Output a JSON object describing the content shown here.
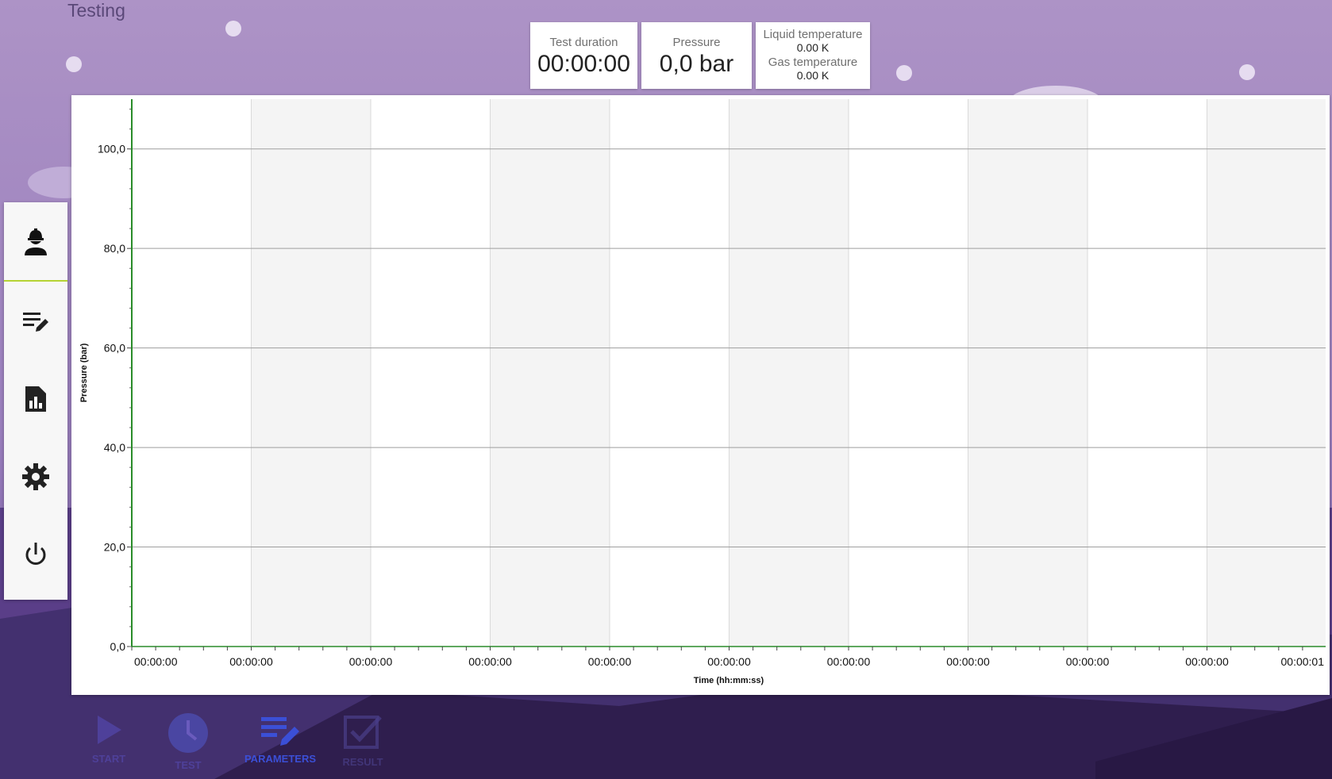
{
  "page": {
    "title": "Testing"
  },
  "stats": {
    "duration_label": "Test duration",
    "duration_value": "00:00:00",
    "pressure_label": "Pressure",
    "pressure_value": "0,0 bar",
    "liquid_temp_label": "Liquid temperature",
    "liquid_temp_value": "0.00 K",
    "gas_temp_label": "Gas temperature",
    "gas_temp_value": "0.00 K"
  },
  "sidebar": {
    "items": [
      {
        "icon": "operator-icon"
      },
      {
        "icon": "edit-list-icon"
      },
      {
        "icon": "report-icon"
      },
      {
        "icon": "gear-icon"
      },
      {
        "icon": "power-icon"
      }
    ],
    "active_index": 0
  },
  "bottom_nav": {
    "items": [
      {
        "label": "START",
        "icon": "play-icon"
      },
      {
        "label": "TEST",
        "icon": "clock-icon"
      },
      {
        "label": "PARAMETERS",
        "icon": "edit-list-icon"
      },
      {
        "label": "RESULT",
        "icon": "check-document-icon"
      }
    ],
    "active_index": 2
  },
  "colors": {
    "bg_top": "#ad93c6",
    "bg_bottom": "#43306f",
    "accent_active": "#3b4fd6",
    "axis_line": "#2a8c2a",
    "side_active_bar": "#b5d334"
  },
  "chart_data": {
    "type": "line",
    "ylabel": "Pressure (bar)",
    "xlabel": "Time (hh:mm:ss)",
    "ylim": [
      0,
      110
    ],
    "y_ticks": [
      "0,0",
      "20,0",
      "40,0",
      "60,0",
      "80,0",
      "100,0"
    ],
    "y_tick_values": [
      0,
      20,
      40,
      60,
      80,
      100
    ],
    "x_ticks": [
      "00:00:00",
      "00:00:00",
      "00:00:00",
      "00:00:00",
      "00:00:00",
      "00:00:00",
      "00:00:00",
      "00:00:00",
      "00:00:00",
      "00:00:00",
      "00:00:01"
    ],
    "series": [],
    "grid": true
  }
}
